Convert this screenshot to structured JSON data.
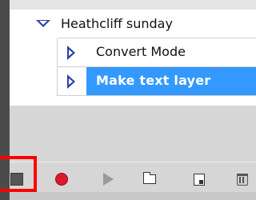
{
  "actions_panel": {
    "set": {
      "name": "Heathcliff sunday",
      "expanded": true,
      "icon": "triangle-down-icon"
    },
    "actions": [
      {
        "label": "Convert Mode",
        "icon": "triangle-right-icon",
        "selected": false
      },
      {
        "label": "Make text layer",
        "icon": "triangle-right-icon",
        "selected": true
      }
    ]
  },
  "toolbar": {
    "buttons": [
      {
        "name": "stop",
        "icon": "stop-square-icon",
        "highlighted": true
      },
      {
        "name": "record",
        "icon": "record-circle-icon"
      },
      {
        "name": "play",
        "icon": "play-triangle-icon"
      },
      {
        "name": "new-set",
        "icon": "folder-icon"
      },
      {
        "name": "new-action",
        "icon": "new-document-icon"
      },
      {
        "name": "delete",
        "icon": "trash-icon"
      }
    ]
  },
  "colors": {
    "selection": "#3399ff",
    "record": "#d91b2c",
    "highlight_box": "#ff0000",
    "arrow": "#2b3fa8"
  }
}
